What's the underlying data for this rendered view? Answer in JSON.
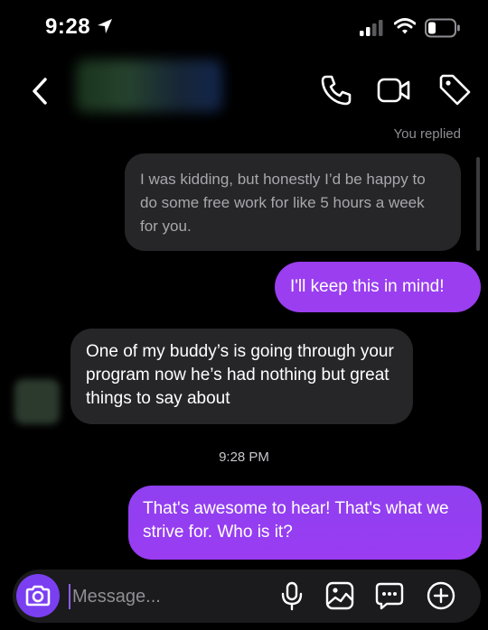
{
  "status_bar": {
    "time": "9:28",
    "icons": [
      "location-arrow-icon",
      "signal-bars-icon",
      "wifi-icon",
      "battery-icon"
    ]
  },
  "header": {
    "contact_name_redacted": true,
    "icons": [
      "back-chevron-icon",
      "phone-icon",
      "video-call-icon",
      "tag-icon"
    ]
  },
  "thread": {
    "replied_label": "You replied",
    "messages": [
      {
        "kind": "quoted",
        "text": "I was kidding, but honestly I’d be happy to do some free work for like 5 hours a week for you."
      },
      {
        "kind": "outgoing",
        "text": "I'll keep this in mind!"
      },
      {
        "kind": "incoming",
        "text": "One of my buddy’s is going through your program now he’s had nothing but great things to say about"
      },
      {
        "kind": "timestamp",
        "text": "9:28 PM"
      },
      {
        "kind": "outgoing",
        "text": "That's awesome to hear! That's what we strive for. Who is it?"
      }
    ]
  },
  "composer": {
    "placeholder": "Message...",
    "value": "",
    "icons": [
      "camera-icon",
      "microphone-icon",
      "gallery-icon",
      "sticker-chat-icon",
      "add-icon"
    ]
  },
  "colors": {
    "background": "#000000",
    "outgoing_bubble": "#9a3ef0",
    "incoming_bubble": "#262629",
    "camera_button": "#7b3ff2",
    "secondary_text": "#8e8e93"
  }
}
